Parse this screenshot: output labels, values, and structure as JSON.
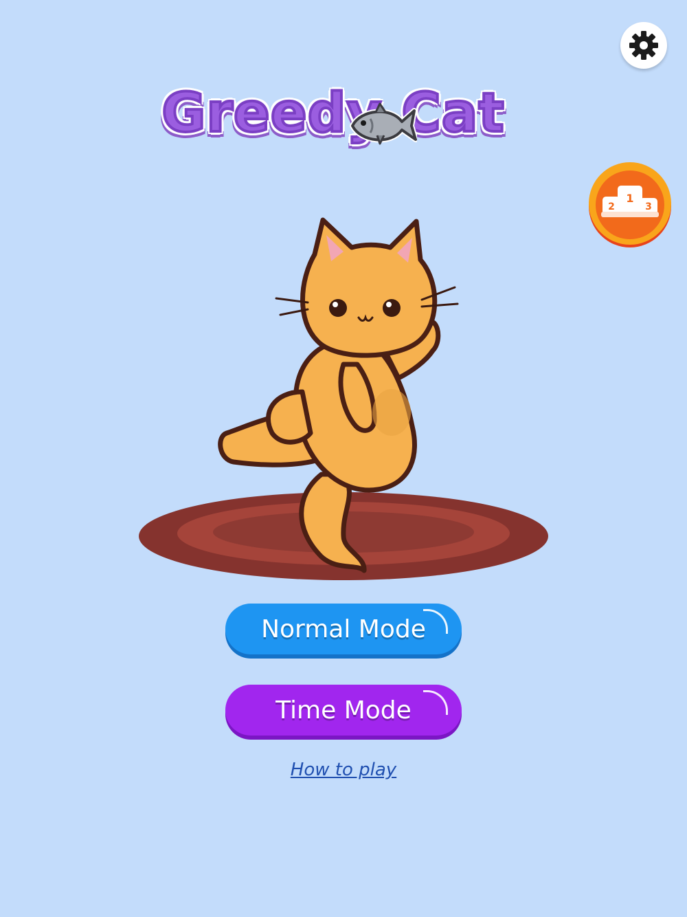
{
  "header": {
    "settings_icon": "gear-icon",
    "leaderboard_icon": "podium-icon",
    "leaderboard_podium_numbers": [
      "1",
      "2",
      "3"
    ]
  },
  "logo": {
    "text": "Greedy Cat",
    "icon": "fish-icon"
  },
  "stage": {
    "character_icon": "cat-icon",
    "rug_icon": "rug-icon"
  },
  "menu": {
    "normal_mode_label": "Normal Mode",
    "time_mode_label": "Time Mode",
    "how_to_play_label": "How to play"
  },
  "colors": {
    "background": "#c3dcfb",
    "normal_button": "#1e95f2",
    "time_button": "#a126ee",
    "logo_purple": "#9b5ee0",
    "leaderboard_orange": "#f26a1b",
    "cat_orange": "#f6b14f",
    "rug_brown": "#85332e"
  }
}
